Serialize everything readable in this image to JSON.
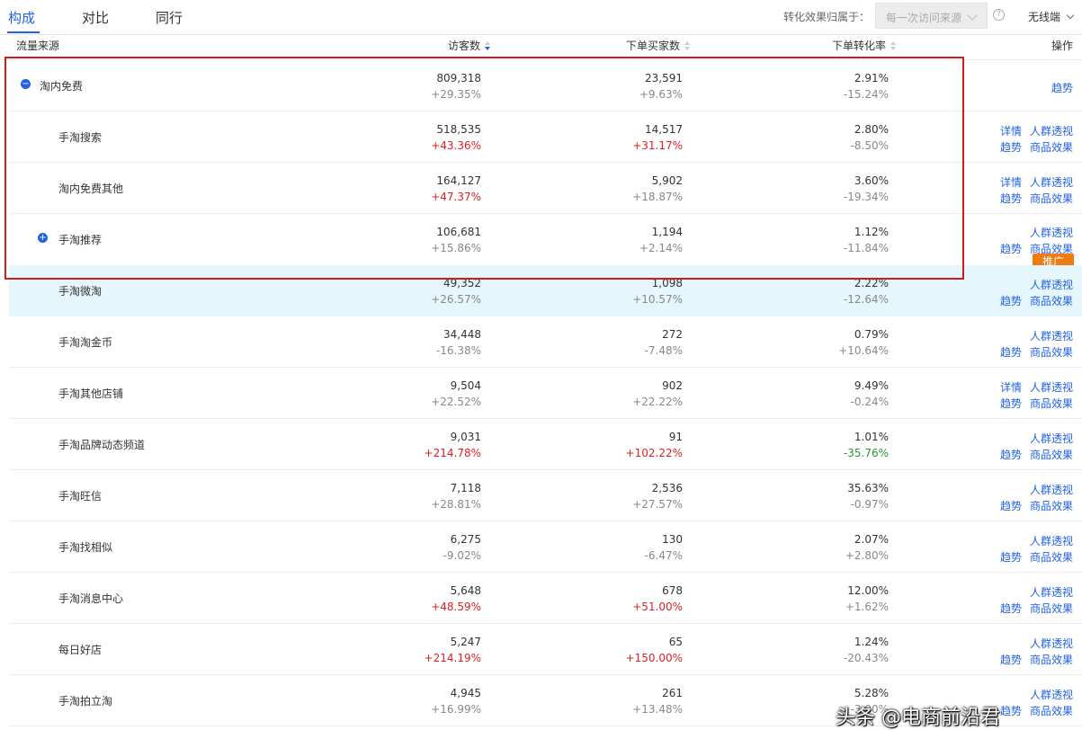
{
  "tabs": [
    {
      "label": "构成",
      "active": true
    },
    {
      "label": "对比",
      "active": false
    },
    {
      "label": "同行",
      "active": false
    }
  ],
  "filter": {
    "conversion_label": "转化效果归属于：",
    "attribution_value": "每一次访问来源",
    "device": "无线端"
  },
  "columns": {
    "source": "流量来源",
    "visitors": "访客数",
    "buyers": "下单买家数",
    "rate": "下单转化率",
    "actions": "操作"
  },
  "rows": [
    {
      "source": "淘内免费",
      "indent": 0,
      "icon": "minus",
      "visitors": "809,318",
      "visitors_change": "+29.35%",
      "buyers": "23,591",
      "buyers_change": "+9.63%",
      "rate": "2.91%",
      "rate_change": "-15.24%",
      "actions": [
        "趋势"
      ]
    },
    {
      "source": "手淘搜索",
      "indent": 1,
      "visitors": "518,535",
      "visitors_change": "+43.36%",
      "visitors_change_color": "up",
      "buyers": "14,517",
      "buyers_change": "+31.17%",
      "buyers_change_color": "up",
      "rate": "2.80%",
      "rate_change": "-8.50%",
      "actions": [
        "详情",
        "人群透视",
        "趋势",
        "商品效果"
      ]
    },
    {
      "source": "淘内免费其他",
      "indent": 1,
      "visitors": "164,127",
      "visitors_change": "+47.37%",
      "visitors_change_color": "up",
      "buyers": "5,902",
      "buyers_change": "+18.87%",
      "rate": "3.60%",
      "rate_change": "-19.34%",
      "actions": [
        "详情",
        "人群透视",
        "趋势",
        "商品效果"
      ]
    },
    {
      "source": "手淘推荐",
      "indent": 1,
      "icon": "plus",
      "visitors": "106,681",
      "visitors_change": "+15.86%",
      "buyers": "1,194",
      "buyers_change": "+2.14%",
      "rate": "1.12%",
      "rate_change": "-11.84%",
      "actions": [
        "人群透视",
        "趋势",
        "商品效果"
      ],
      "promo": "推广"
    },
    {
      "source": "手淘微淘",
      "indent": 1,
      "highlight": true,
      "visitors": "49,352",
      "visitors_change": "+26.57%",
      "buyers": "1,098",
      "buyers_change": "+10.57%",
      "rate": "2.22%",
      "rate_change": "-12.64%",
      "actions": [
        "人群透视",
        "趋势",
        "商品效果"
      ]
    },
    {
      "source": "手淘淘金币",
      "indent": 1,
      "visitors": "34,448",
      "visitors_change": "-16.38%",
      "buyers": "272",
      "buyers_change": "-7.48%",
      "rate": "0.79%",
      "rate_change": "+10.64%",
      "actions": [
        "人群透视",
        "趋势",
        "商品效果"
      ]
    },
    {
      "source": "手淘其他店铺",
      "indent": 1,
      "visitors": "9,504",
      "visitors_change": "+22.52%",
      "buyers": "902",
      "buyers_change": "+22.22%",
      "rate": "9.49%",
      "rate_change": "-0.24%",
      "actions": [
        "详情",
        "人群透视",
        "趋势",
        "商品效果"
      ]
    },
    {
      "source": "手淘品牌动态频道",
      "indent": 1,
      "visitors": "9,031",
      "visitors_change": "+214.78%",
      "visitors_change_color": "up",
      "buyers": "91",
      "buyers_change": "+102.22%",
      "buyers_change_color": "up",
      "rate": "1.01%",
      "rate_change": "-35.76%",
      "rate_change_color": "down",
      "actions": [
        "人群透视",
        "趋势",
        "商品效果"
      ]
    },
    {
      "source": "手淘旺信",
      "indent": 1,
      "visitors": "7,118",
      "visitors_change": "+28.81%",
      "buyers": "2,536",
      "buyers_change": "+27.57%",
      "rate": "35.63%",
      "rate_change": "-0.97%",
      "actions": [
        "人群透视",
        "趋势",
        "商品效果"
      ]
    },
    {
      "source": "手淘找相似",
      "indent": 1,
      "visitors": "6,275",
      "visitors_change": "-9.02%",
      "buyers": "130",
      "buyers_change": "-6.47%",
      "rate": "2.07%",
      "rate_change": "+2.80%",
      "actions": [
        "人群透视",
        "趋势",
        "商品效果"
      ]
    },
    {
      "source": "手淘消息中心",
      "indent": 1,
      "visitors": "5,648",
      "visitors_change": "+48.59%",
      "visitors_change_color": "up",
      "buyers": "678",
      "buyers_change": "+51.00%",
      "buyers_change_color": "up",
      "rate": "12.00%",
      "rate_change": "+1.62%",
      "actions": [
        "人群透视",
        "趋势",
        "商品效果"
      ]
    },
    {
      "source": "每日好店",
      "indent": 1,
      "visitors": "5,247",
      "visitors_change": "+214.19%",
      "visitors_change_color": "up",
      "buyers": "65",
      "buyers_change": "+150.00%",
      "buyers_change_color": "up",
      "rate": "1.24%",
      "rate_change": "-20.43%",
      "actions": [
        "人群透视",
        "趋势",
        "商品效果"
      ]
    },
    {
      "source": "手淘拍立淘",
      "indent": 1,
      "visitors": "4,945",
      "visitors_change": "+16.99%",
      "buyers": "261",
      "buyers_change": "+13.48%",
      "rate": "5.28%",
      "rate_change": "-3.00%",
      "actions": [
        "人群透视",
        "趋势",
        "商品效果"
      ]
    }
  ],
  "watermark": "头条 @电商前沿君"
}
